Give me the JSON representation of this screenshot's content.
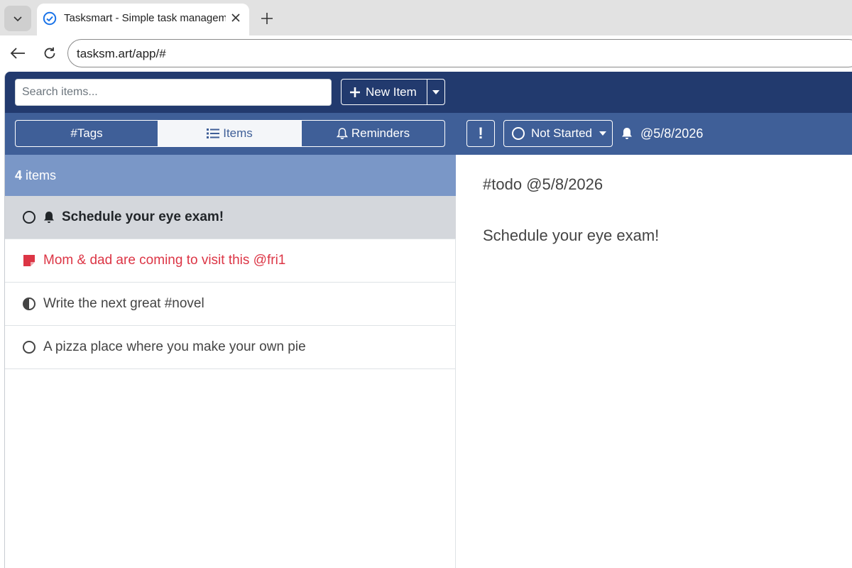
{
  "browser": {
    "tab_title": "Tasksmart - Simple task management",
    "url": "tasksm.art/app/#"
  },
  "app": {
    "search": {
      "placeholder": "Search items..."
    },
    "new_item_label": "New Item",
    "tabs": [
      {
        "label": "#Tags",
        "icon": ""
      },
      {
        "label": "Items",
        "icon": "list-icon",
        "active": true
      },
      {
        "label": "Reminders",
        "icon": "bell-outline-icon"
      }
    ],
    "count": {
      "number": "4",
      "label": "items"
    },
    "items": [
      {
        "text": "Schedule your eye exam!",
        "icons": [
          "circle-outline-icon",
          "bell-icon"
        ],
        "selected": true
      },
      {
        "text": "Mom & dad are coming to visit this @fri1",
        "icons": [
          "sticky-note-icon"
        ],
        "color": "#dc3545"
      },
      {
        "text": "Write the next great #novel",
        "icons": [
          "half-circle-icon"
        ]
      },
      {
        "text": "A pizza place where you make your own pie",
        "icons": [
          "circle-outline-icon"
        ]
      }
    ],
    "detail_toolbar": {
      "priority_label": "!",
      "status_label": "Not Started",
      "reminder_date": "@5/8/2026"
    },
    "detail": {
      "tags_line": "#todo @5/8/2026",
      "body": "Schedule your eye exam!"
    }
  },
  "colors": {
    "header_dark": "#223a6e",
    "header_mid": "#3f5f98",
    "count_bar": "#7a97c7",
    "selected_row": "#d4d7dc",
    "accent_red": "#dc3545"
  }
}
